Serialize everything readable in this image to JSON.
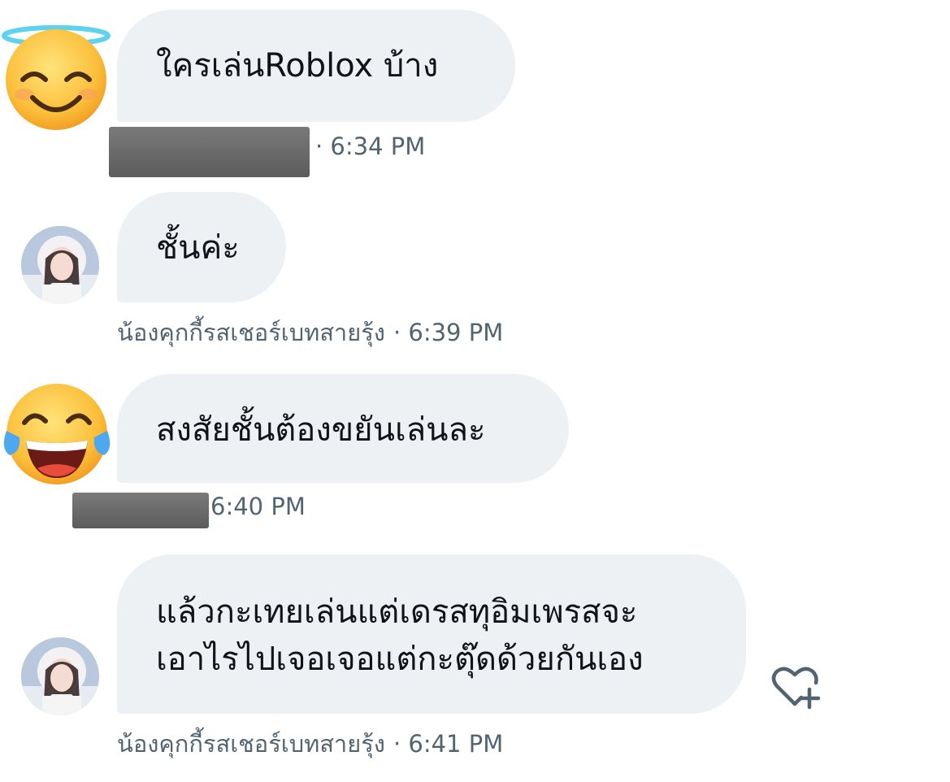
{
  "messages": [
    {
      "text": "ใครเล่นRoblox บ้าง",
      "sender": "",
      "time": "· 6:34 PM",
      "avatar": "smiling-face-with-halo-icon"
    },
    {
      "text": "ชั้นค่ะ",
      "sender": "น้องคุกกี้รสเชอร์เบทสายรุ้ง",
      "time": "· 6:39 PM",
      "avatar": "profile-photo"
    },
    {
      "text": "สงสัยชั้นต้องขยันเล่นละ",
      "sender": "",
      "time": "6:40 PM",
      "avatar": "face-with-tears-of-joy-icon"
    },
    {
      "text": "แล้วกะเทยเล่นแต่เดรสทุอิมเพรสจะ\nเอาไรไปเจอเจอแต่กะตุ๊ดด้วยกันเอง",
      "sender": "น้องคุกกี้รสเชอร์เบทสายรุ้ง",
      "time": "· 6:41 PM",
      "avatar": "profile-photo"
    }
  ],
  "icons": {
    "react": "heart-plus-icon"
  },
  "colors": {
    "bubble_bg": "#eef1f3",
    "text": "#0f1419",
    "meta_text": "#536471",
    "redaction": "#6b6b6b"
  }
}
